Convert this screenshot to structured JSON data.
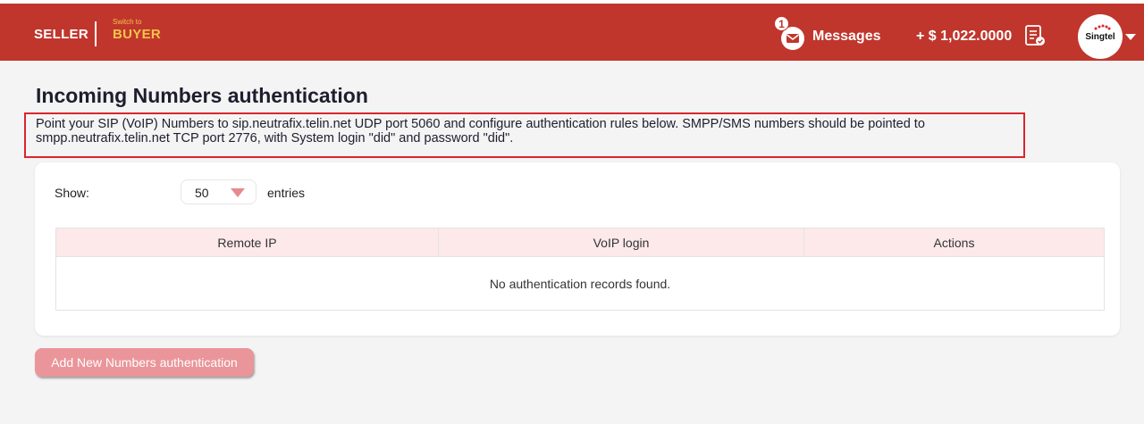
{
  "header": {
    "seller_label": "SELLER",
    "switch_small": "Switch to",
    "switch_big": "BUYER",
    "messages_badge": "1",
    "messages_label": "Messages",
    "balance": "+ $ 1,022.0000",
    "avatar_text": "Singtel",
    "colors": {
      "bar": "#c0362c",
      "switch": "#f3c34a"
    }
  },
  "main": {
    "title": "Incoming Numbers authentication",
    "info_text": "Point your SIP (VoIP) Numbers to sip.neutrafix.telin.net UDP port 5060 and configure authentication rules below. SMPP/SMS numbers should be pointed to smpp.neutrafix.telin.net TCP port 2776, with System login \"did\" and password \"did\".",
    "show_label": "Show:",
    "entries_value": "50",
    "entries_label": "entries",
    "table": {
      "columns": [
        "Remote IP",
        "VoIP login",
        "Actions"
      ],
      "empty_message": "No authentication records found."
    },
    "add_button_label": "Add New Numbers authentication"
  }
}
